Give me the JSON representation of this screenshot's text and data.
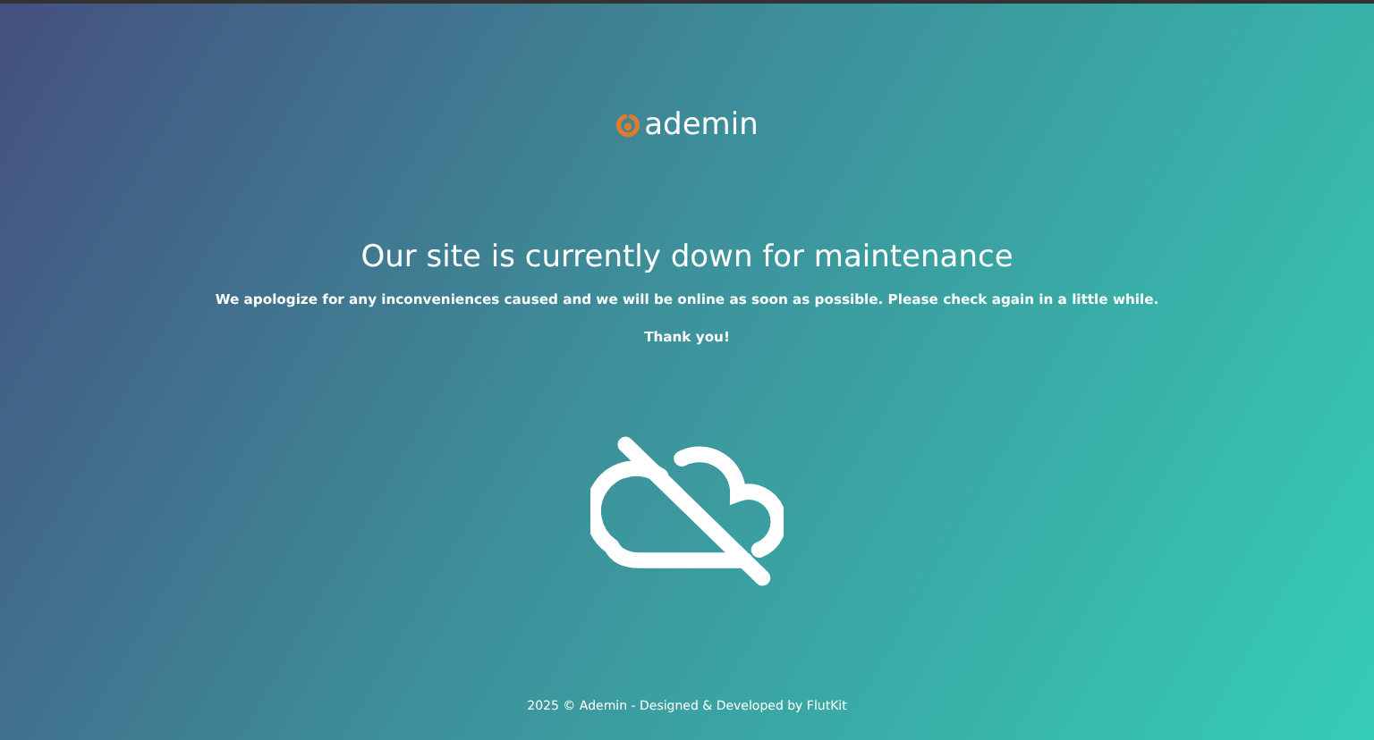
{
  "logo": {
    "text": "ademin"
  },
  "heading": "Our site is currently down for maintenance",
  "message": "We apologize for any inconveniences caused and we will be online as soon as possible. Please check again in a little while.",
  "thanks": "Thank you!",
  "footer": "2025 © Ademin - Designed & Developed by FlutKit"
}
